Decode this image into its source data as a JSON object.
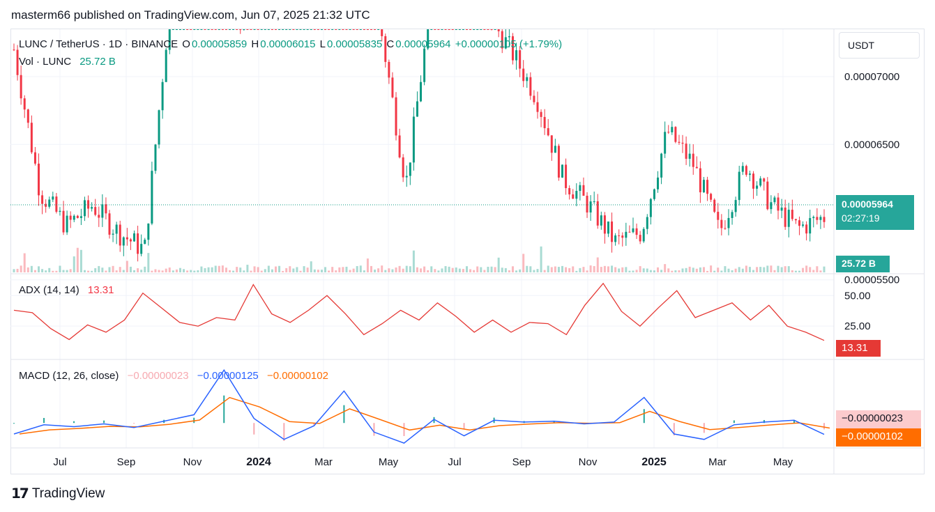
{
  "header": {
    "published": "masterm66 published on TradingView.com, Jun 07, 2025 21:32 UTC"
  },
  "symbol": {
    "name": "LUNC / TetherUS · 1D · BINANCE",
    "o_label": "O",
    "o": "0.00005859",
    "h_label": "H",
    "h": "0.00006015",
    "l_label": "L",
    "l": "0.00005835",
    "c_label": "C",
    "c": "0.00005964",
    "change": "+0.00000105 (+1.79%)"
  },
  "volume": {
    "label": "Vol · LUNC",
    "value": "25.72 B"
  },
  "currency_button": "USDT",
  "price_axis": [
    "0.00007000",
    "0.00006500",
    "0.00005500"
  ],
  "price_badge": {
    "price": "0.00005964",
    "countdown": "02:27:19",
    "volume": "25.72 B"
  },
  "adx": {
    "label": "ADX (14, 14)",
    "value": "13.31",
    "axis": [
      "50.00",
      "25.00"
    ]
  },
  "macd": {
    "label": "MACD (12, 26, close)",
    "hist": "−0.00000023",
    "macd": "−0.00000125",
    "signal": "−0.00000102",
    "badge_hist": "−0.00000023",
    "badge_signal": "−0.00000102"
  },
  "time_axis": [
    "Jul",
    "Sep",
    "Nov",
    "2024",
    "Mar",
    "May",
    "Jul",
    "Sep",
    "Nov",
    "2025",
    "Mar",
    "May"
  ],
  "footer": {
    "brand": "TradingView"
  },
  "colors": {
    "up": "#089981",
    "down": "#f23645",
    "adx": "#e53935",
    "macd": "#2962ff",
    "signal": "#ff6d00"
  },
  "chart_data": [
    {
      "type": "candlestick",
      "series": "LUNC/USDT daily price",
      "ylim": [
        5.55e-05,
        7.35e-05
      ],
      "last": {
        "open": 5.859e-05,
        "high": 6.015e-05,
        "low": 5.835e-05,
        "close": 5.964e-05
      },
      "x_ticks": [
        "Jul",
        "Sep",
        "Nov",
        "2024",
        "Mar",
        "May",
        "Jul",
        "Sep",
        "Nov",
        "2025",
        "Mar",
        "May"
      ],
      "y_ticks": [
        7e-05,
        6.5e-05,
        5.5e-05
      ],
      "closes": [
        7.2e-05,
        6.15e-05,
        5.9e-05,
        6.05e-05,
        5.85e-05,
        5.72e-05,
        7.6e-05,
        7.8e-05,
        7.5e-05,
        7.4e-05,
        7.7e-05,
        7.9e-05,
        7.8e-05,
        7.7e-05,
        7.4e-05,
        6.2e-05,
        7.6e-05,
        7.5e-05,
        7.5e-05,
        7.2e-05,
        6.85e-05,
        6.25e-05,
        6.05e-05,
        5.78e-05,
        5.85e-05,
        6.6e-05,
        6.35e-05,
        5.85e-05,
        6.35e-05,
        6.05e-05,
        5.88e-05,
        5.964e-05
      ]
    },
    {
      "type": "bar",
      "series": "Vol · LUNC",
      "last_value": "25.72 B"
    },
    {
      "type": "line",
      "series": "ADX (14, 14)",
      "ylim": [
        0,
        65
      ],
      "y_ticks": [
        50,
        25
      ],
      "values": [
        38,
        36,
        23,
        14,
        26,
        20,
        30,
        52,
        40,
        28,
        25,
        32,
        30,
        59,
        35,
        28,
        38,
        50,
        35,
        18,
        27,
        38,
        30,
        44,
        33,
        20,
        30,
        20,
        28,
        27,
        18,
        42,
        60,
        37,
        25,
        40,
        54,
        32,
        38,
        44,
        30,
        42,
        25,
        20,
        13.31
      ]
    },
    {
      "type": "line",
      "series": "MACD (12, 26, close)",
      "lines": [
        "MACD",
        "signal",
        "histogram"
      ],
      "ylim": [
        -2.5e-06,
        6.5e-06
      ],
      "last": {
        "histogram": -2.3e-07,
        "macd": -1.25e-06,
        "signal": -1.02e-06
      },
      "macd_values": [
        -1.2e-06,
        -2e-07,
        -4e-07,
        -1e-07,
        -5e-07,
        2e-07,
        9e-07,
        5.8e-06,
        5e-07,
        -1.8e-06,
        -3e-07,
        3.5e-06,
        -1e-06,
        -2.2e-06,
        4e-07,
        -1.4e-06,
        3e-07,
        1e-07,
        2e-07,
        -1e-07,
        1e-07,
        2.8e-06,
        -1.2e-06,
        -1.8e-06,
        -2e-07,
        1e-07,
        3e-07,
        -1.25e-06
      ]
    }
  ]
}
